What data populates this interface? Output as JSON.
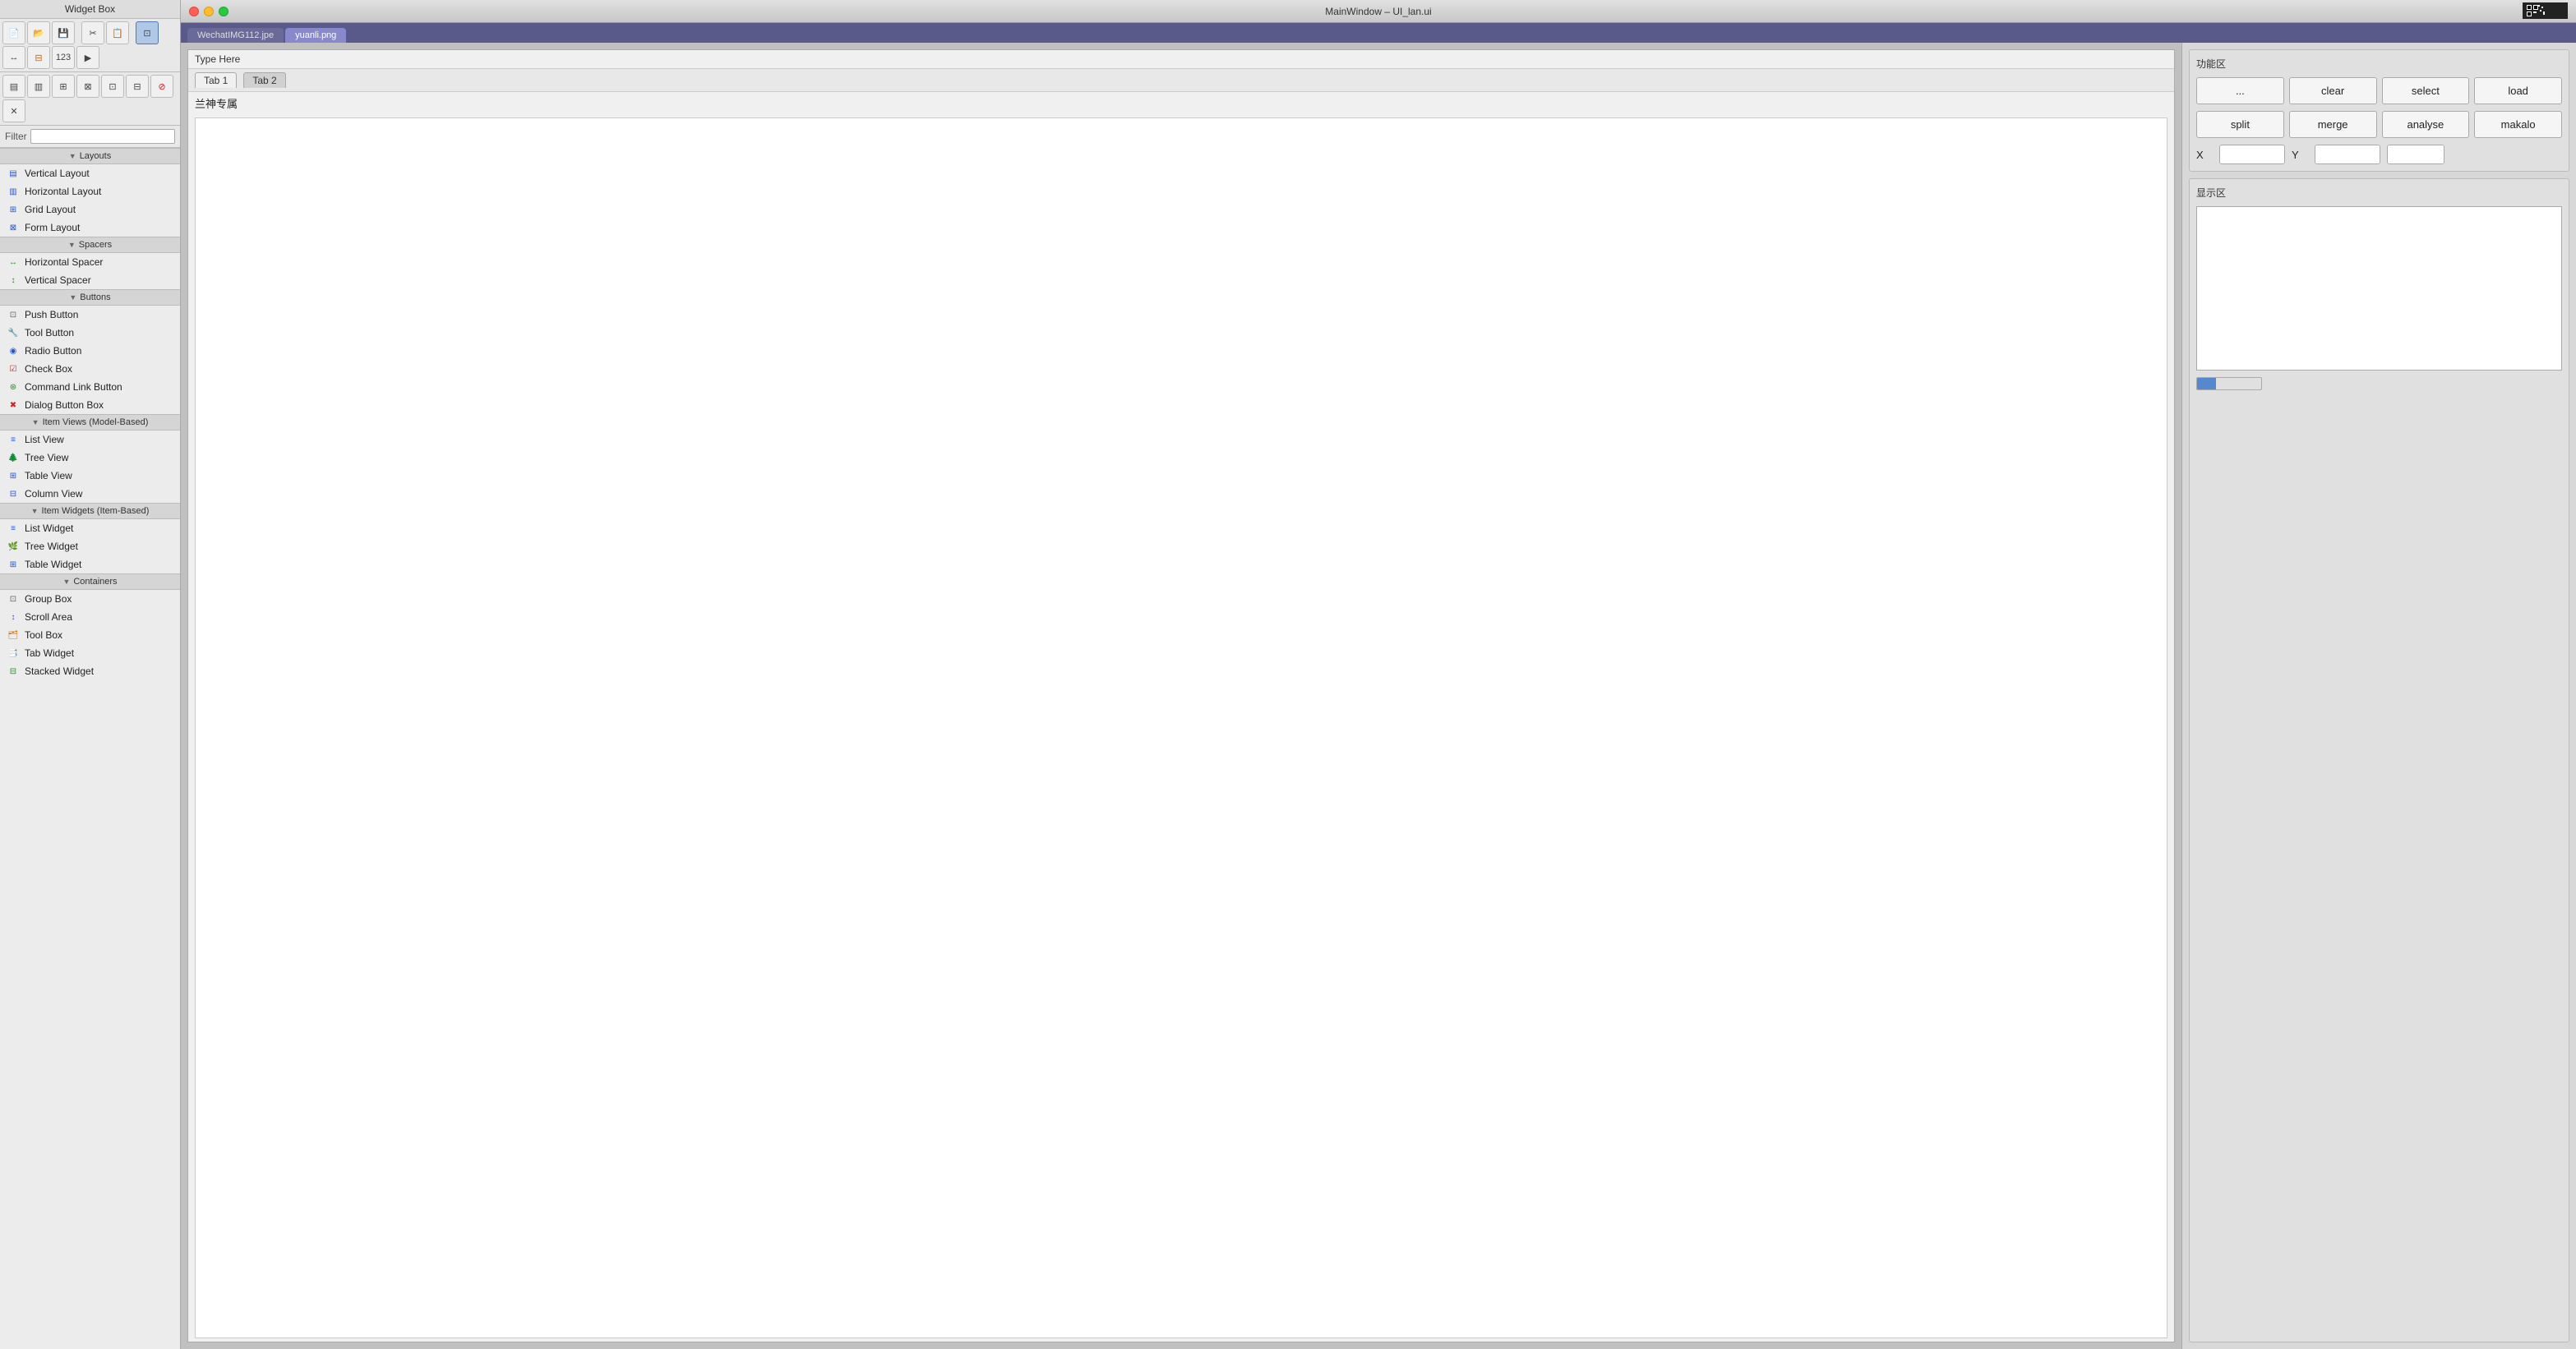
{
  "widget_box": {
    "title": "Widget Box",
    "toolbar_buttons_row1": [
      {
        "name": "new-btn",
        "icon": "📄"
      },
      {
        "name": "open-btn",
        "icon": "📁"
      },
      {
        "name": "save-btn",
        "icon": "💾"
      },
      {
        "name": "cut-btn",
        "icon": "✂️"
      },
      {
        "name": "copy-btn",
        "icon": "📋"
      },
      {
        "name": "adjust-size-btn",
        "icon": "⊡"
      },
      {
        "name": "horizontal-layout-btn",
        "icon": "⬜"
      },
      {
        "name": "rotate-btn",
        "icon": "↻"
      },
      {
        "name": "numbers-btn",
        "icon": "123"
      }
    ],
    "toolbar_buttons_row2": [
      {
        "name": "layout-h-btn",
        "icon": "≡"
      },
      {
        "name": "layout-v-btn",
        "icon": "⊟"
      },
      {
        "name": "layout-grid-btn",
        "icon": "⊞"
      },
      {
        "name": "layout-form-btn",
        "icon": "⊠"
      },
      {
        "name": "layout-table-btn",
        "icon": "⊡"
      },
      {
        "name": "layout-splitter-btn",
        "icon": "⊟"
      },
      {
        "name": "break-layout-btn",
        "icon": "⊘"
      },
      {
        "name": "adjust-btn",
        "icon": "✕"
      }
    ],
    "filter_label": "Filter",
    "filter_placeholder": "",
    "sections": [
      {
        "name": "Layouts",
        "items": [
          {
            "label": "Vertical Layout",
            "icon": "▤"
          },
          {
            "label": "Horizontal Layout",
            "icon": "▥"
          },
          {
            "label": "Grid Layout",
            "icon": "▦"
          },
          {
            "label": "Form Layout",
            "icon": "▧"
          }
        ]
      },
      {
        "name": "Spacers",
        "items": [
          {
            "label": "Horizontal Spacer",
            "icon": "↔"
          },
          {
            "label": "Vertical Spacer",
            "icon": "↕"
          }
        ]
      },
      {
        "name": "Buttons",
        "items": [
          {
            "label": "Push Button",
            "icon": "⊡"
          },
          {
            "label": "Tool Button",
            "icon": "🔧"
          },
          {
            "label": "Radio Button",
            "icon": "◉"
          },
          {
            "label": "Check Box",
            "icon": "☑"
          },
          {
            "label": "Command Link Button",
            "icon": "⊛"
          },
          {
            "label": "Dialog Button Box",
            "icon": "⊟"
          }
        ]
      },
      {
        "name": "Item Views (Model-Based)",
        "items": [
          {
            "label": "List View",
            "icon": "≡"
          },
          {
            "label": "Tree View",
            "icon": "🌲"
          },
          {
            "label": "Table View",
            "icon": "⊞"
          },
          {
            "label": "Column View",
            "icon": "⊟"
          }
        ]
      },
      {
        "name": "Item Widgets (Item-Based)",
        "items": [
          {
            "label": "List Widget",
            "icon": "≡"
          },
          {
            "label": "Tree Widget",
            "icon": "🌿"
          },
          {
            "label": "Table Widget",
            "icon": "⊞"
          }
        ]
      },
      {
        "name": "Containers",
        "items": [
          {
            "label": "Group Box",
            "icon": "⊡"
          },
          {
            "label": "Scroll Area",
            "icon": "↕"
          },
          {
            "label": "Tool Box",
            "icon": "🗂"
          },
          {
            "label": "Tab Widget",
            "icon": "📑"
          },
          {
            "label": "Stacked Widget",
            "icon": "⊟"
          }
        ]
      }
    ]
  },
  "window": {
    "title": "MainWindow – UI_lan.ui",
    "file_tabs": [
      {
        "label": "WechatIMG112.jpe",
        "active": false
      },
      {
        "label": "yuanli.png",
        "active": false
      }
    ],
    "form": {
      "menu_bar": "Type Here",
      "tabs": [
        {
          "label": "Tab 1",
          "active": true
        },
        {
          "label": "Tab 2",
          "active": false
        }
      ],
      "lan_label": "兰神专属"
    }
  },
  "right_panel": {
    "functional_section_title": "功能区",
    "row1_buttons": [
      {
        "label": "...",
        "name": "dots-btn"
      },
      {
        "label": "clear",
        "name": "clear-btn"
      },
      {
        "label": "select",
        "name": "select-btn"
      },
      {
        "label": "load",
        "name": "load-btn"
      }
    ],
    "row2_buttons": [
      {
        "label": "split",
        "name": "split-btn"
      },
      {
        "label": "merge",
        "name": "merge-btn"
      },
      {
        "label": "analyse",
        "name": "analyse-btn"
      },
      {
        "label": "makalo",
        "name": "makalo-btn"
      }
    ],
    "x_label": "X",
    "y_label": "Y",
    "x_value": "",
    "y_value": "",
    "dropdown_value": "",
    "display_section_title": "显示区",
    "progress_value": 30
  }
}
